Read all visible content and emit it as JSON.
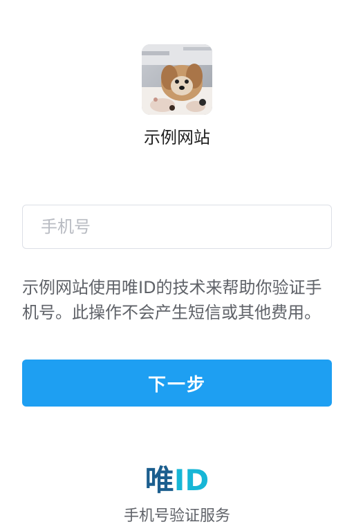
{
  "site": {
    "name": "示例网站",
    "logo_icon": "dog-photo-logo"
  },
  "phone_input": {
    "placeholder": "手机号",
    "value": ""
  },
  "notice_text": "示例网站使用唯ID的技术来帮助你验证手机号。此操作不会产生短信或其他费用。",
  "next_button_label": "下一步",
  "brand": {
    "name_cn": "唯",
    "name_id": "ID",
    "caption": "手机号验证服务"
  },
  "colors": {
    "primary_button": "#1e9ff2",
    "brand_dark": "#1b5e8e",
    "brand_light": "#17b6d6"
  }
}
